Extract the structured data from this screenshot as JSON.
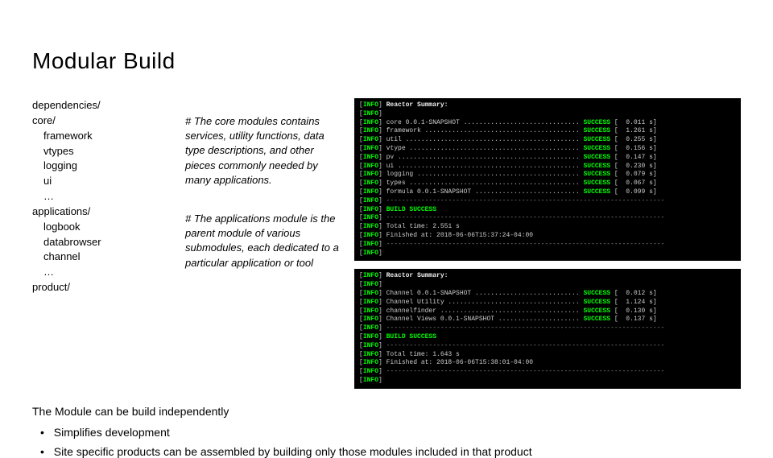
{
  "title": "Modular Build",
  "tree": {
    "l1": "dependencies/",
    "l2": "core/",
    "l3": "framework",
    "l4": "vtypes",
    "l5": "logging",
    "l6": "ui",
    "l7": "…",
    "l8": "applications/",
    "l9": "logbook",
    "l10": "databrowser",
    "l11": "channel",
    "l12": "…",
    "l13": "product/"
  },
  "desc": {
    "p1": "# The core modules contains services, utility functions, data type descriptions, and other pieces commonly needed by many applications.",
    "p2": "# The applications module is the parent module of various submodules, each dedicated to a particular application or tool"
  },
  "term1": {
    "summary": "Reactor Summary:",
    "rows": [
      {
        "name": "core 0.0.1-SNAPSHOT",
        "dots": "..............................",
        "status": "SUCCESS",
        "time": "0.011 s"
      },
      {
        "name": "framework",
        "dots": "........................................",
        "status": "SUCCESS",
        "time": "1.261 s"
      },
      {
        "name": "util",
        "dots": ".............................................",
        "status": "SUCCESS",
        "time": "0.255 s"
      },
      {
        "name": "vtype",
        "dots": "............................................",
        "status": "SUCCESS",
        "time": "0.156 s"
      },
      {
        "name": "pv",
        "dots": "...............................................",
        "status": "SUCCESS",
        "time": "0.147 s"
      },
      {
        "name": "ui",
        "dots": "...............................................",
        "status": "SUCCESS",
        "time": "0.230 s"
      },
      {
        "name": "logging",
        "dots": "..........................................",
        "status": "SUCCESS",
        "time": "0.079 s"
      },
      {
        "name": "types",
        "dots": "............................................",
        "status": "SUCCESS",
        "time": "0.067 s"
      },
      {
        "name": "formula 0.0.1-SNAPSHOT",
        "dots": "...........................",
        "status": "SUCCESS",
        "time": "0.099 s"
      }
    ],
    "build": "BUILD SUCCESS",
    "total": "Total time: 2.551 s",
    "finished": "Finished at: 2018-06-06T15:37:24-04:00"
  },
  "term2": {
    "summary": "Reactor Summary:",
    "rows": [
      {
        "name": "Channel 0.0.1-SNAPSHOT",
        "dots": "...........................",
        "status": "SUCCESS",
        "time": "0.012 s"
      },
      {
        "name": "Channel Utility",
        "dots": "..................................",
        "status": "SUCCESS",
        "time": "1.124 s"
      },
      {
        "name": "channelfinder",
        "dots": "....................................",
        "status": "SUCCESS",
        "time": "0.130 s"
      },
      {
        "name": "Channel Views 0.0.1-SNAPSHOT",
        "dots": ".....................",
        "status": "SUCCESS",
        "time": "0.137 s"
      }
    ],
    "build": "BUILD SUCCESS",
    "total": "Total time: 1.643 s",
    "finished": "Finished at: 2018-06-06T15:38:01-04:00"
  },
  "footer": {
    "lead": "The Module can be build independently",
    "b1": "Simplifies development",
    "b2": "Site specific products can be assembled by building only those modules included in that product"
  }
}
